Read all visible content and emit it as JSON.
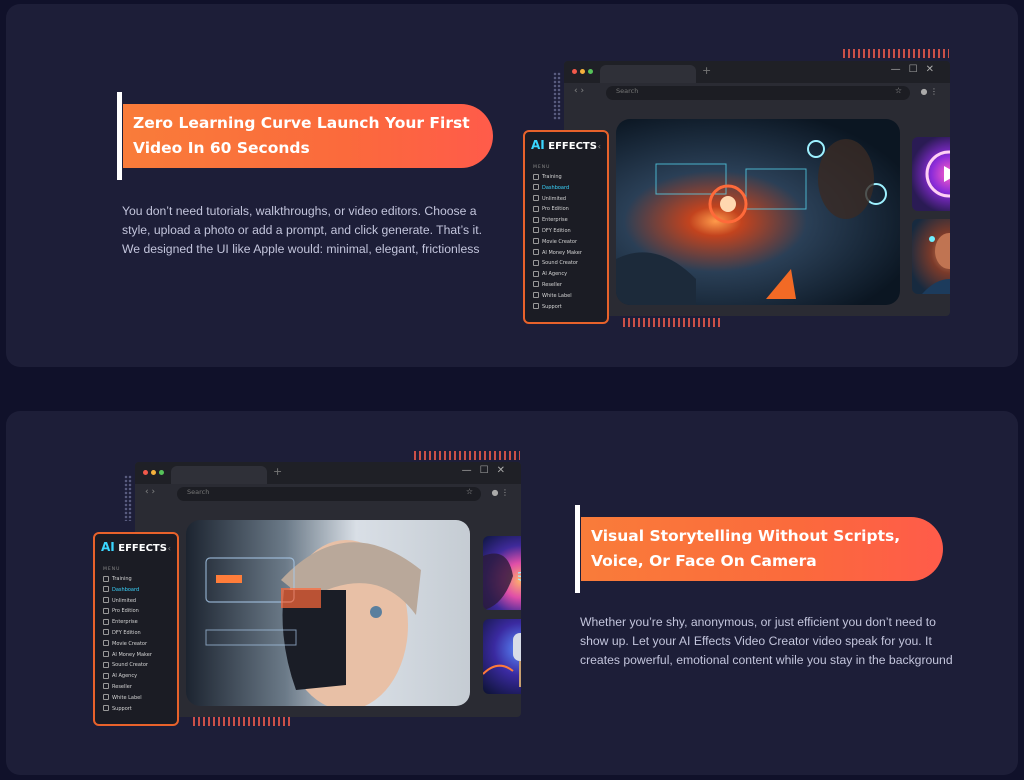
{
  "section1": {
    "heading": "Zero Learning Curve Launch Your First Video In 60 Seconds",
    "paragraph": "You don’t need tutorials, walkthroughs, or video editors. Choose a style, upload a photo or add a prompt, and click generate. That’s it. We designed the UI like Apple would: minimal, elegant, frictionless",
    "browser": {
      "search_placeholder": "Search",
      "star": "☆",
      "window_controls": "—☐✕"
    }
  },
  "section2": {
    "heading": "Visual Storytelling Without Scripts, Voice, Or Face On Camera",
    "paragraph": "Whether you’re shy, anonymous, or just efficient you don’t need to show up. Let your AI Effects Video Creator video speak for you. It creates powerful, emotional content while you stay in the background",
    "browser": {
      "search_placeholder": "Search",
      "star": "☆",
      "window_controls": "—☐✕"
    }
  },
  "sidebar": {
    "logo_ai": "AI",
    "logo_effects": "EFFECTS",
    "menu_heading": "MENU",
    "items": [
      "Training",
      "Dashboard",
      "Unlimited",
      "Pro Edition",
      "Enterprise",
      "DFY Edition",
      "Movie Creator",
      "AI Money Maker",
      "Sound Creator",
      "AI Agency",
      "Reseller",
      "White Label",
      "Support"
    ]
  },
  "colors": {
    "accent_orange": "#f97c3a",
    "accent_cyan": "#3ad6ff",
    "card_bg": "#1d1e38",
    "page_bg": "#10112a"
  }
}
